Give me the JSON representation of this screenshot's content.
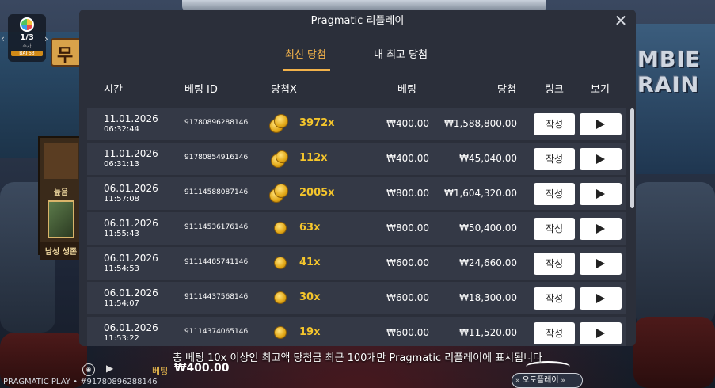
{
  "modal": {
    "title": "Pragmatic 리플레이",
    "tabs": [
      "최신 당첨",
      "내 최고 당첨"
    ],
    "headers": {
      "time": "시간",
      "bet_id": "베팅 ID",
      "multiplier": "당첨X",
      "bet": "베팅",
      "win": "당첨",
      "link": "링크",
      "view": "보기"
    },
    "rows": [
      {
        "date": "11.01.2026",
        "time": "06:32:44",
        "bet_id": "91780896288146",
        "mult": "3972x",
        "bet": "₩400.00",
        "win": "₩1,588,800.00",
        "link_label": "작성"
      },
      {
        "date": "11.01.2026",
        "time": "06:31:13",
        "bet_id": "91780854916146",
        "mult": "112x",
        "bet": "₩400.00",
        "win": "₩45,040.00",
        "link_label": "작성"
      },
      {
        "date": "06.01.2026",
        "time": "11:57:08",
        "bet_id": "91114588087146",
        "mult": "2005x",
        "bet": "₩800.00",
        "win": "₩1,604,320.00",
        "link_label": "작성"
      },
      {
        "date": "06.01.2026",
        "time": "11:55:43",
        "bet_id": "91114536176146",
        "mult": "63x",
        "bet": "₩800.00",
        "win": "₩50,400.00",
        "link_label": "작성"
      },
      {
        "date": "06.01.2026",
        "time": "11:54:53",
        "bet_id": "91114485741146",
        "mult": "41x",
        "bet": "₩600.00",
        "win": "₩24,660.00",
        "link_label": "작성"
      },
      {
        "date": "06.01.2026",
        "time": "11:54:07",
        "bet_id": "91114437568146",
        "mult": "30x",
        "bet": "₩600.00",
        "win": "₩18,300.00",
        "link_label": "작성"
      },
      {
        "date": "06.01.2026",
        "time": "11:53:22",
        "bet_id": "91114374065146",
        "mult": "19x",
        "bet": "₩600.00",
        "win": "₩11,520.00",
        "link_label": "작성"
      }
    ]
  },
  "footnote": "총 베팅 10x 이상인 최고액 당첨금 최근 100개만 Pragmatic 리플레이에 표시됩니다",
  "background": {
    "logo_line1": "MBIE",
    "logo_line2": "RAIN",
    "left_sign": "무",
    "spin_badge_count": "1/3",
    "spin_badge_sub": "추가",
    "spin_badge_tag": "BAI 53",
    "feature_label_top": "늪음",
    "feature_label_bottom": "남성 생존",
    "brand": "PRAGMATIC PLAY • #91780896288146",
    "bet_label": "베팅",
    "bet_value": "₩400.00",
    "autoplay_label": "오토플레이"
  },
  "colors": {
    "accent": "#f2b24a",
    "multiplier": "#f4c52c",
    "modal_bg": "#2b2f3a",
    "row_bg": "#343946"
  }
}
